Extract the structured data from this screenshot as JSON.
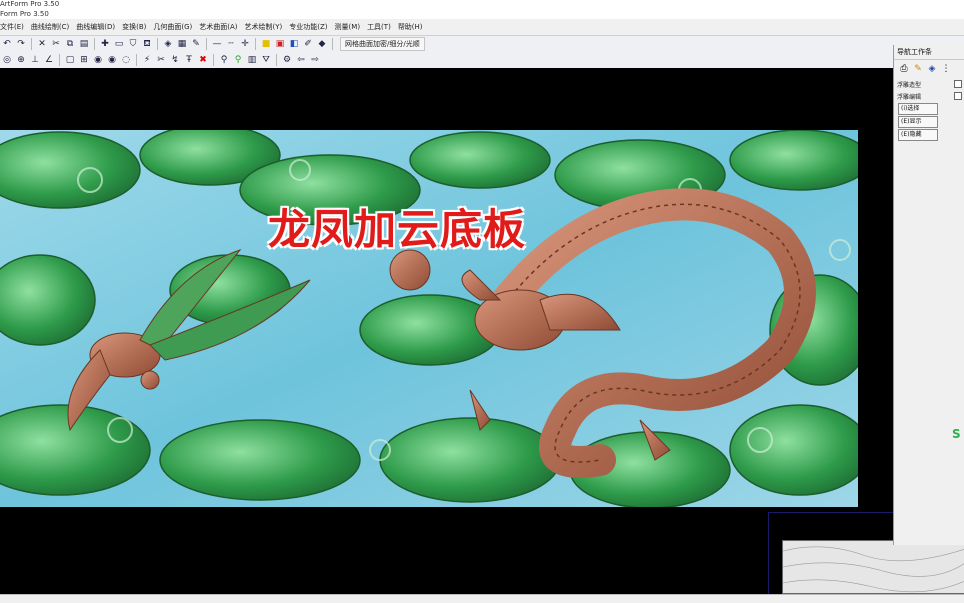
{
  "window": {
    "title": "ArtForm Pro 3.50",
    "subtitle": "Form Pro 3.50"
  },
  "menu": [
    "文件(E)",
    "曲线绘制(C)",
    "曲线编辑(D)",
    "变换(B)",
    "几何曲面(G)",
    "艺术曲面(A)",
    "艺术绘制(Y)",
    "专业功能(Z)",
    "测量(M)",
    "工具(T)",
    "帮助(H)"
  ],
  "toolbar": {
    "text_button": "网格曲面加密/细分/光顺"
  },
  "canvas": {
    "overlay_title": "龙凤加云底板"
  },
  "panel": {
    "title": "导航工作条",
    "rows": [
      {
        "label": "浮雕造型"
      },
      {
        "label": "浮雕编辑"
      }
    ],
    "buttons": [
      "(i)选择",
      "(E)显示",
      "(E)隐藏"
    ]
  },
  "colors": {
    "cloud_green": "#2e9b4a",
    "background_blue": "#7fd3e6",
    "dragon_copper": "#b0664a",
    "title_red": "#e11a1a"
  }
}
